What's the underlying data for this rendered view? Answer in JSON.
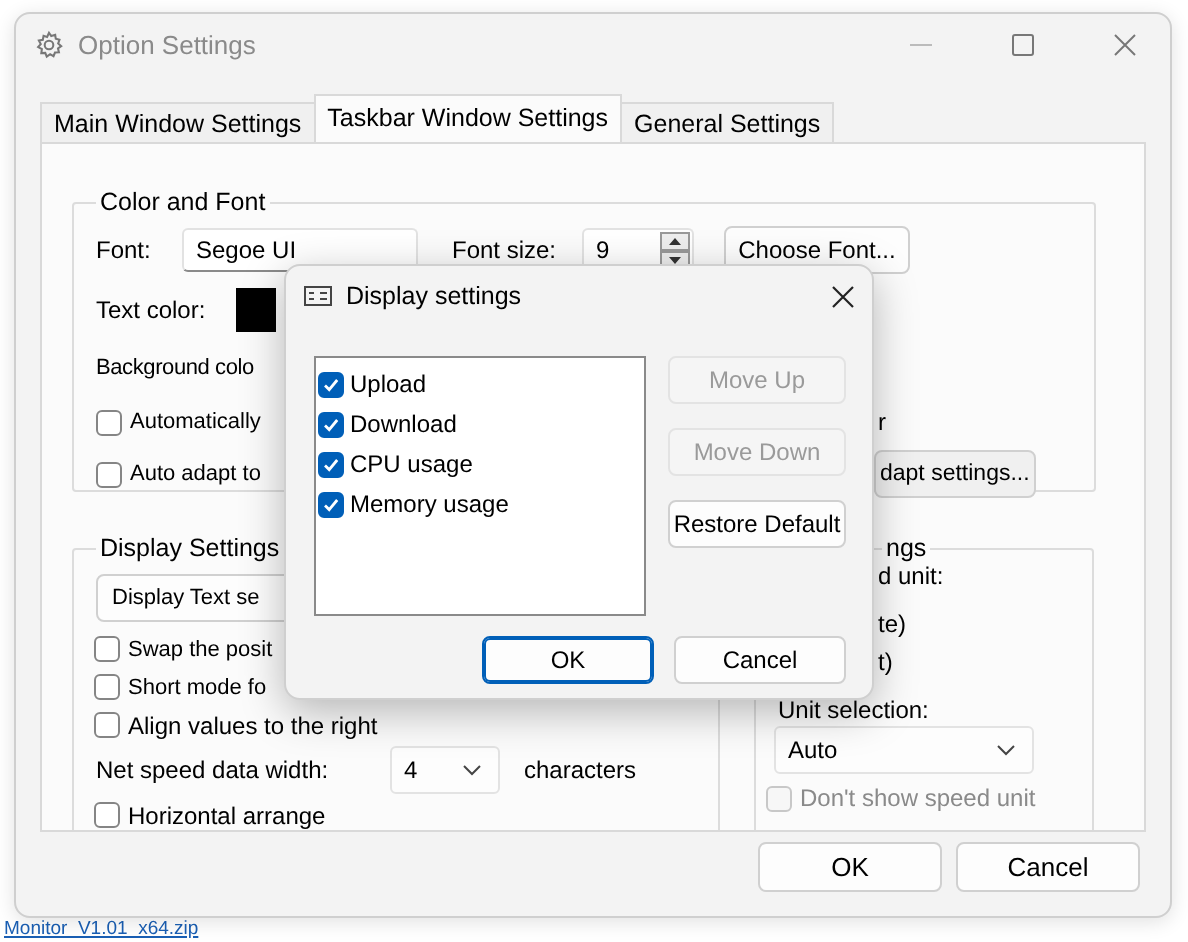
{
  "window": {
    "title": "Option Settings"
  },
  "tabs": [
    {
      "label": "Main Window Settings",
      "selected": false
    },
    {
      "label": "Taskbar Window Settings",
      "selected": true
    },
    {
      "label": "General Settings",
      "selected": false
    }
  ],
  "color_and_font": {
    "title": "Color and Font",
    "font_label": "Font:",
    "font_value": "Segoe UI",
    "font_size_label": "Font size:",
    "font_size_value": "9",
    "choose_font_button": "Choose Font...",
    "text_color": {
      "label": "Text color:",
      "color": "#000000"
    },
    "background_color_label": "Background colo",
    "auto_checkbox": {
      "label": "Automatically",
      "checked": false
    },
    "trailing_text": "r",
    "adapt_checkbox": {
      "label": "Auto adapt to",
      "checked": false
    },
    "adapt_button": "dapt settings..."
  },
  "display_settings": {
    "title": "Display Settings",
    "button": "Display Text se",
    "items": [
      {
        "kind": "checkbox",
        "label": "Swap the posit",
        "checked": false
      },
      {
        "kind": "checkbox",
        "label": "Short mode fo",
        "checked": false
      },
      {
        "kind": "checkbox",
        "label": "Align values to the right",
        "checked": false
      },
      {
        "kind": "combo",
        "label": "Net speed data width:",
        "value": "4",
        "unit": "characters"
      },
      {
        "kind": "checkbox",
        "label": "Horizontal arrange",
        "checked": false
      }
    ]
  },
  "speed_group": {
    "title": "ngs",
    "texts": [
      "d unit:",
      "te)",
      "t)"
    ],
    "unit_label": "Unit selection:",
    "unit_value": "Auto",
    "speed_unit_checkbox": {
      "label": "Don't show speed unit",
      "checked": false,
      "disabled": true
    }
  },
  "buttons": [
    {
      "label": "OK"
    },
    {
      "label": "Cancel"
    }
  ],
  "dialog": {
    "title": "Display settings",
    "items": [
      {
        "label": "Upload",
        "checked": true
      },
      {
        "label": "Download",
        "checked": true
      },
      {
        "label": "CPU usage",
        "checked": true
      },
      {
        "label": "Memory usage",
        "checked": true
      }
    ],
    "side_buttons": [
      {
        "label": "Move Up",
        "disabled": true
      },
      {
        "label": "Move Down",
        "disabled": true
      },
      {
        "label": "Restore Default",
        "disabled": false
      }
    ],
    "buttons": [
      {
        "label": "OK",
        "default": true
      },
      {
        "label": "Cancel",
        "default": false
      }
    ]
  },
  "desktop": {
    "link": "Monitor_V1.01_x64.zip"
  }
}
